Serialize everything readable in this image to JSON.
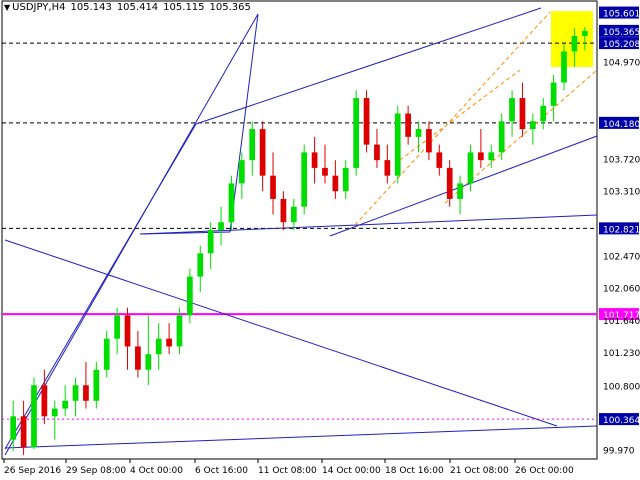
{
  "header": {
    "symbol": "USDJPY,H4",
    "open": "105.143",
    "high": "105.414",
    "low": "105.115",
    "close": "105.365"
  },
  "colors": {
    "background": "#ffffff",
    "bull_candle": "#00dd00",
    "bear_candle": "#dd0000",
    "support_resistance": "#0000aa",
    "trendline": "#2020c0",
    "channel": "#ff8c00",
    "key_level": "#ff00ff",
    "target_zone": "#ffff00",
    "price_label": "#0000aa"
  },
  "chart_data": {
    "type": "candlestick",
    "ylim": [
      99.85,
      105.75
    ],
    "y_ticks": [
      "105.601",
      "105.365",
      "105.208",
      "104.970",
      "104.180",
      "103.720",
      "103.310",
      "102.821",
      "102.470",
      "102.060",
      "101.717",
      "101.640",
      "101.230",
      "100.800",
      "100.364",
      "99.970"
    ],
    "x_ticks": [
      "26 Sep 2016",
      "29 Sep 08:00",
      "4 Oct 00:00",
      "6 Oct 16:00",
      "11 Oct 08:00",
      "14 Oct 00:00",
      "18 Oct 16:00",
      "21 Oct 08:00",
      "26 Oct 00:00"
    ],
    "highlighted_levels": [
      "105.601",
      "105.365",
      "105.208",
      "104.180",
      "102.821",
      "101.717",
      "100.364"
    ],
    "candles": [
      [
        100.1,
        100.6,
        99.95,
        100.4
      ],
      [
        100.4,
        100.6,
        99.9,
        100.0
      ],
      [
        100.0,
        100.9,
        99.98,
        100.8
      ],
      [
        100.8,
        101.0,
        100.3,
        100.4
      ],
      [
        100.4,
        100.6,
        100.1,
        100.5
      ],
      [
        100.5,
        100.8,
        100.4,
        100.6
      ],
      [
        100.6,
        100.9,
        100.4,
        100.8
      ],
      [
        100.8,
        101.1,
        100.5,
        100.6
      ],
      [
        100.6,
        101.1,
        100.5,
        101.0
      ],
      [
        101.0,
        101.5,
        100.9,
        101.4
      ],
      [
        101.4,
        101.8,
        101.2,
        101.7
      ],
      [
        101.7,
        101.8,
        101.0,
        101.3
      ],
      [
        101.3,
        101.5,
        100.9,
        101.0
      ],
      [
        101.0,
        101.7,
        100.8,
        101.2
      ],
      [
        101.2,
        101.6,
        101.0,
        101.4
      ],
      [
        101.4,
        101.6,
        101.2,
        101.3
      ],
      [
        101.3,
        101.8,
        101.2,
        101.7
      ],
      [
        101.7,
        102.3,
        101.6,
        102.2
      ],
      [
        102.2,
        102.6,
        102.0,
        102.5
      ],
      [
        102.5,
        102.9,
        102.3,
        102.8
      ],
      [
        102.8,
        103.1,
        102.6,
        102.9
      ],
      [
        102.9,
        103.5,
        102.8,
        103.4
      ],
      [
        103.4,
        103.8,
        103.2,
        103.7
      ],
      [
        103.7,
        104.2,
        103.5,
        104.1
      ],
      [
        104.1,
        104.2,
        103.3,
        103.5
      ],
      [
        103.5,
        103.8,
        103.0,
        103.2
      ],
      [
        103.2,
        103.3,
        102.8,
        102.9
      ],
      [
        102.9,
        103.2,
        102.8,
        103.1
      ],
      [
        103.1,
        103.9,
        103.0,
        103.8
      ],
      [
        103.8,
        104.0,
        103.4,
        103.6
      ],
      [
        103.6,
        103.9,
        103.4,
        103.5
      ],
      [
        103.5,
        103.7,
        103.2,
        103.3
      ],
      [
        103.3,
        103.7,
        103.2,
        103.6
      ],
      [
        103.6,
        104.6,
        103.5,
        104.5
      ],
      [
        104.5,
        104.6,
        103.8,
        103.9
      ],
      [
        103.9,
        104.1,
        103.6,
        103.7
      ],
      [
        103.7,
        103.9,
        103.4,
        103.5
      ],
      [
        103.5,
        104.4,
        103.4,
        104.3
      ],
      [
        104.3,
        104.4,
        103.9,
        104.0
      ],
      [
        104.0,
        104.2,
        103.8,
        104.1
      ],
      [
        104.1,
        104.2,
        103.7,
        103.8
      ],
      [
        103.8,
        103.9,
        103.5,
        103.6
      ],
      [
        103.6,
        103.7,
        103.1,
        103.2
      ],
      [
        103.2,
        103.5,
        103.0,
        103.4
      ],
      [
        103.4,
        103.9,
        103.3,
        103.8
      ],
      [
        103.8,
        104.1,
        103.6,
        103.7
      ],
      [
        103.7,
        103.9,
        103.6,
        103.8
      ],
      [
        103.8,
        104.3,
        103.7,
        104.2
      ],
      [
        104.2,
        104.6,
        104.0,
        104.5
      ],
      [
        104.5,
        104.7,
        104.0,
        104.1
      ],
      [
        104.1,
        104.3,
        103.9,
        104.2
      ],
      [
        104.2,
        104.5,
        104.1,
        104.4
      ],
      [
        104.4,
        104.8,
        104.2,
        104.7
      ],
      [
        104.7,
        105.2,
        104.6,
        105.1
      ],
      [
        105.1,
        105.4,
        104.9,
        105.3
      ],
      [
        105.3,
        105.414,
        105.115,
        105.365
      ]
    ]
  }
}
